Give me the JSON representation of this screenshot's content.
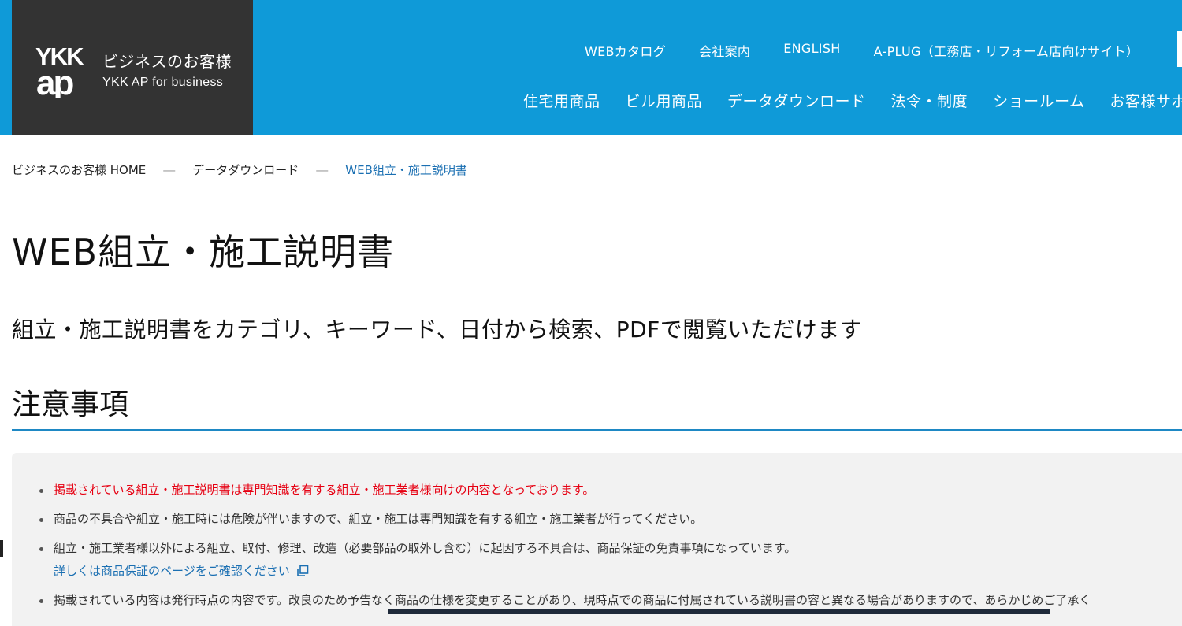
{
  "header": {
    "logo_text": "YKK AP",
    "logo_title_jp": "ビジネスのお客様",
    "logo_title_en": "YKK AP for business",
    "utility_nav": [
      {
        "label": "WEBカタログ"
      },
      {
        "label": "会社案内"
      },
      {
        "label": "ENGLISH"
      },
      {
        "label": "A-PLUG（工務店・リフォーム店向けサイト）"
      }
    ],
    "main_nav": [
      {
        "label": "住宅用商品"
      },
      {
        "label": "ビル用商品"
      },
      {
        "label": "データダウンロード"
      },
      {
        "label": "法令・制度"
      },
      {
        "label": "ショールーム"
      },
      {
        "label": "お客様サポ"
      }
    ],
    "colors": {
      "bar": "#0f9ad8",
      "logo_bg": "#333333"
    }
  },
  "breadcrumb": {
    "home": "ビジネスのお客様 HOME",
    "separator": "―",
    "level2": "データダウンロード",
    "current": "WEB組立・施工説明書"
  },
  "page": {
    "title": "WEB組立・施工説明書",
    "lead": "組立・施工説明書をカテゴリ、キーワード、日付から検索、PDFで閲覧いただけます"
  },
  "notice": {
    "heading": "注意事項",
    "items": [
      {
        "text": "掲載されている組立・施工説明書は専門知識を有する組立・施工業者様向けの内容となっております。"
      },
      {
        "text": "商品の不具合や組立・施工時には危険が伴いますので、組立・施工は専門知識を有する組立・施工業者が行ってください。"
      },
      {
        "text": "組立・施工業者様以外による組立、取付、修理、改造（必要部品の取外し含む）に起因する不具合は、商品保証の免責事項になっています。",
        "link": "詳しくは商品保証のページをご確認ください"
      },
      {
        "text": "掲載されている内容は発行時点の内容です。改良のため予告なく商品の仕様を変更することがあり、現時点での商品に付属されている説明書の容と異なる場合がありますので、あらかじめご了承く"
      }
    ],
    "colors": {
      "warning": "#e60012",
      "link": "#1a6fb2",
      "rule": "#1e88c4"
    }
  }
}
